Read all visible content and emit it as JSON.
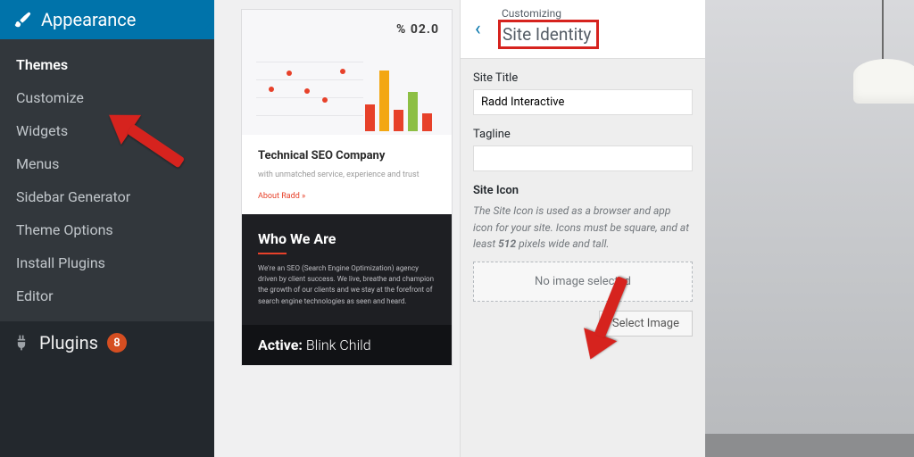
{
  "sidebar": {
    "appearance_label": "Appearance",
    "items": [
      {
        "label": "Themes"
      },
      {
        "label": "Customize"
      },
      {
        "label": "Widgets"
      },
      {
        "label": "Menus"
      },
      {
        "label": "Sidebar Generator"
      },
      {
        "label": "Theme Options"
      },
      {
        "label": "Install Plugins"
      },
      {
        "label": "Editor"
      }
    ],
    "plugins_label": "Plugins",
    "plugins_count": "8"
  },
  "preview": {
    "pct": "% 02.0",
    "mid_title": "Technical SEO Company",
    "mid_sub": "with unmatched service, experience and trust",
    "mid_link": "About Radd »",
    "who_title": "Who We Are",
    "who_text": "We're an SEO (Search Engine Optimization) agency driven by client success. We live, breathe and champion the growth of our clients and we stay at the forefront of search engine technologies as seen and heard.",
    "active_label": "Active:",
    "active_theme": "Blink Child"
  },
  "customizer": {
    "crumb": "Customizing",
    "section": "Site Identity",
    "site_title_label": "Site Title",
    "site_title_value": "Radd Interactive",
    "tagline_label": "Tagline",
    "tagline_value": "",
    "icon_label": "Site Icon",
    "icon_desc_pre": "The Site Icon is used as a browser and app icon for your site. Icons must be square, and at least ",
    "icon_desc_bold": "512",
    "icon_desc_post": " pixels wide and tall.",
    "no_image": "No image selected",
    "select_image": "Select Image"
  }
}
